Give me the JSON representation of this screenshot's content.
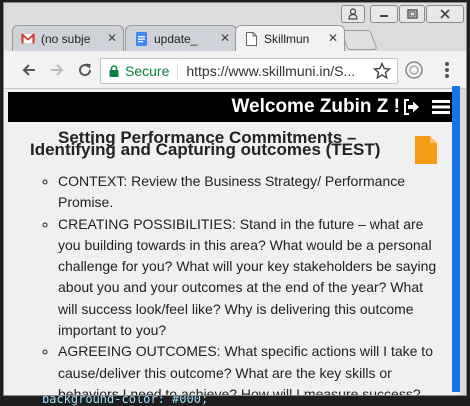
{
  "editor": {
    "visible_code": "background-color: #000;"
  },
  "browser": {
    "tabs": [
      {
        "label": "(no subje",
        "icon": "gmail-icon",
        "active": false
      },
      {
        "label": "update_",
        "icon": "docs-icon",
        "active": false
      },
      {
        "label": "Skillmun",
        "icon": "page-icon",
        "active": true
      }
    ],
    "secure_label": "Secure",
    "url": "https://www.skillmuni.in/S..."
  },
  "site": {
    "welcome": "Welcome Zubin Z !",
    "title_line1": "Setting Performance Commitments –",
    "title_line2": "Identifying and Capturing outcomes (TEST)",
    "items": [
      "CONTEXT: Review the Business Strategy/ Performance Promise.",
      "CREATING POSSIBILITIES: Stand in the future – what are you building towards in this area?  What would be a personal challenge for you?  What will your key stakeholders be saying about you and your outcomes at the end of the year?  What will success look/feel like?  Why is delivering this outcome important to you?",
      "AGREEING OUTCOMES: What specific actions will I take to cause/deliver this outcome? What are the key skills or behaviors I need to achieve? How will I measure success?"
    ]
  },
  "colors": {
    "accent": "#1a73e8",
    "doc_icon": "#f59b16",
    "secure": "#0b8043",
    "topbar": "#000000"
  }
}
